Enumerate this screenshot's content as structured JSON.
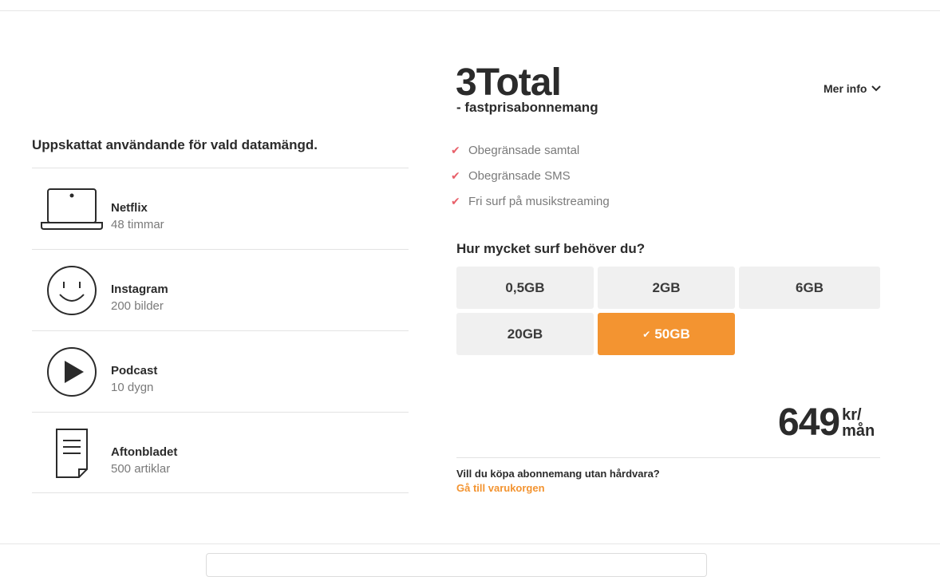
{
  "left": {
    "heading": "Uppskattat användande för vald datamängd.",
    "items": [
      {
        "icon": "laptop-icon",
        "title": "Netflix",
        "detail": "48 timmar"
      },
      {
        "icon": "smiley-icon",
        "title": "Instagram",
        "detail": "200 bilder"
      },
      {
        "icon": "play-icon",
        "title": "Podcast",
        "detail": "10 dygn"
      },
      {
        "icon": "document-icon",
        "title": "Aftonbladet",
        "detail": "500 artiklar"
      }
    ]
  },
  "product": {
    "title": "3Total",
    "subtitle": "- fastprisabonnemang",
    "more_info": "Mer info",
    "features": [
      "Obegränsade samtal",
      "Obegränsade SMS",
      "Fri surf på musikstreaming"
    ],
    "check_color": "#e8606a"
  },
  "data_selector": {
    "question": "Hur mycket surf behöver du?",
    "options": [
      "0,5GB",
      "2GB",
      "6GB",
      "20GB",
      "50GB"
    ],
    "selected": "50GB",
    "selected_color": "#f39431"
  },
  "price": {
    "amount": "649",
    "unit_line1": "kr/",
    "unit_line2": "mån"
  },
  "no_hardware": {
    "question": "Vill du köpa abonnemang utan hårdvara?",
    "link": "Gå till varukorgen"
  }
}
